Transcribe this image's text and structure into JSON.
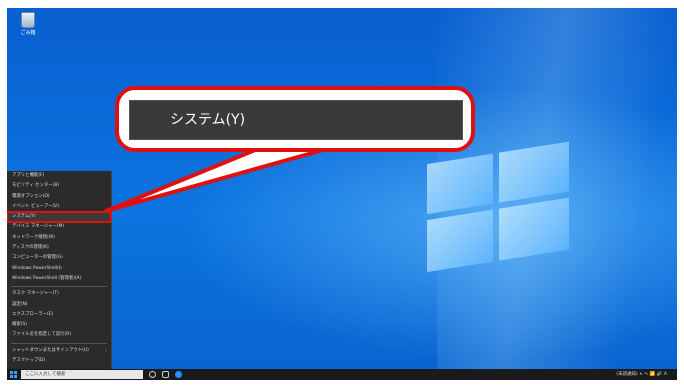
{
  "desktop": {
    "recycle_bin_label": "ごみ箱"
  },
  "callout": {
    "text": "システム(Y)"
  },
  "menu": {
    "items": [
      {
        "label": "アプリと機能(F)"
      },
      {
        "label": "モビリティ センター(B)"
      },
      {
        "label": "電源オプション(O)"
      },
      {
        "label": "イベント ビューアー(V)"
      },
      {
        "label": "システム(Y)"
      },
      {
        "label": "デバイス マネージャー(M)"
      },
      {
        "label": "ネットワーク接続(W)"
      },
      {
        "label": "ディスクの管理(K)"
      },
      {
        "label": "コンピューターの管理(G)"
      },
      {
        "label": "Windows PowerShell(I)"
      },
      {
        "label": "Windows PowerShell (管理者)(A)"
      },
      {
        "label": "タスク マネージャー(T)"
      },
      {
        "label": "設定(N)"
      },
      {
        "label": "エクスプローラー(E)"
      },
      {
        "label": "検索(S)"
      },
      {
        "label": "ファイル名を指定して実行(R)"
      },
      {
        "label": "シャットダウンまたはサインアウト(U)"
      },
      {
        "label": "デスクトップ(D)"
      }
    ]
  },
  "taskbar": {
    "search_placeholder": "ここに入力して検索",
    "tray_text": "(未読通知) ∧ へ 📶 🔊 A"
  }
}
